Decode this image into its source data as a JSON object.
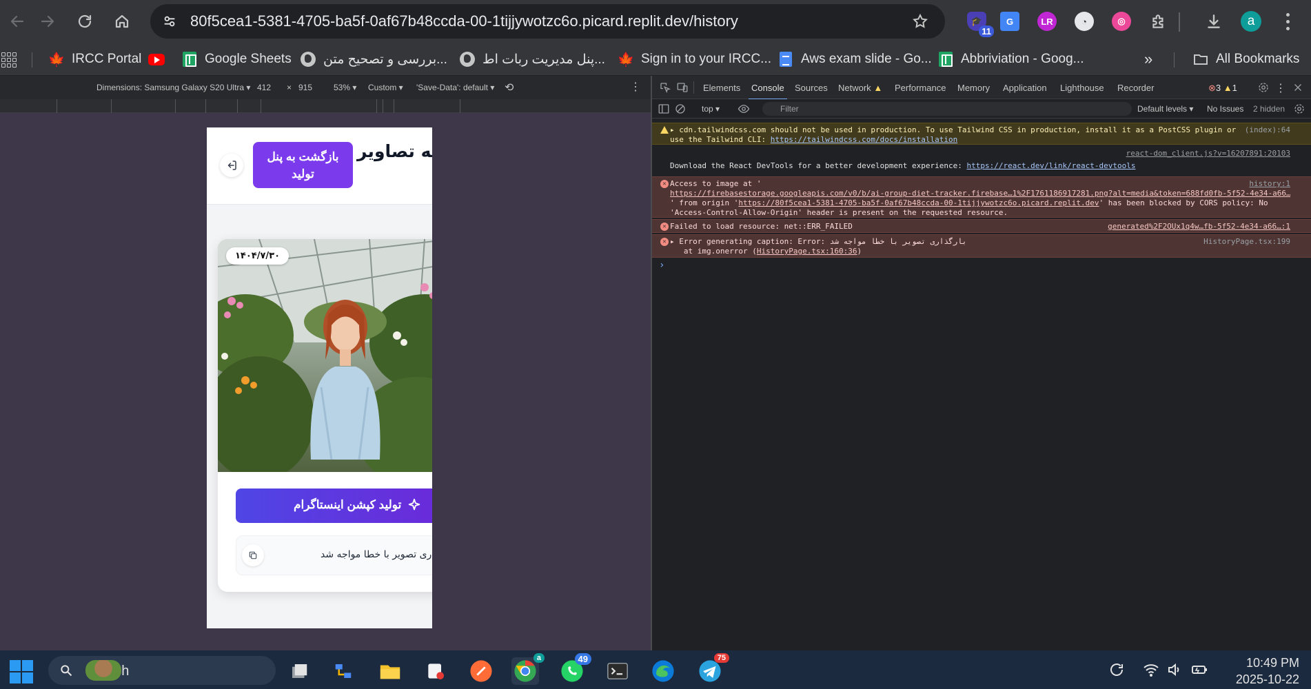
{
  "browser": {
    "url": "80f5cea1-5381-4705-ba5f-0af67b48ccda-00-1tijjywotzc6o.picard.replit.dev/history",
    "extension_badge": "11",
    "profile_initial": "a"
  },
  "bookmarks": [
    {
      "label": "IRCC Portal",
      "icon": "maple-leaf-icon"
    },
    {
      "label": "",
      "icon": "youtube-icon"
    },
    {
      "label": "Google Sheets",
      "icon": "sheets-icon"
    },
    {
      "label": "...بررسی و تصحیح متن",
      "icon": "globe-icon"
    },
    {
      "label": "...پنل مدیریت ربات اط",
      "icon": "globe-icon"
    },
    {
      "label": "Sign in to your IRCC...",
      "icon": "maple-leaf-icon"
    },
    {
      "label": "Aws exam slide - Go...",
      "icon": "docs-icon"
    },
    {
      "label": "Abbriviation - Goog...",
      "icon": "sheets-icon"
    }
  ],
  "bookmarks_all": "All Bookmarks",
  "device_toolbar": {
    "dimensions": "Dimensions: Samsung Galaxy S20 Ultra",
    "width": "412",
    "times": "×",
    "height": "915",
    "zoom": "53%",
    "throttle": "Custom",
    "save_data": "'Save-Data': default"
  },
  "app": {
    "title": "تاریخچه تصاویر",
    "back_button": "بازگشت به پنل تولید",
    "date": "۱۴۰۴/۷/۳۰",
    "generate_caption_button": "تولید کپشن اینستاگرام",
    "caption_text": "بارگذاری تصویر با خطا مواجه شد"
  },
  "devtools": {
    "tabs": [
      "Elements",
      "Console",
      "Sources",
      "Network",
      "Performance",
      "Memory",
      "Application",
      "Lighthouse",
      "Recorder"
    ],
    "active_tab": "Console",
    "error_count": "3",
    "warning_count": "1",
    "context": "top",
    "filter_placeholder": "Filter",
    "levels": "Default levels",
    "issues": "No Issues",
    "hidden": "2 hidden",
    "messages": [
      {
        "type": "warn",
        "text_a": "cdn.tailwindcss.com should not be used in production. To use Tailwind CSS in production, install it as a PostCSS plugin or",
        "text_b": "use the Tailwind CLI: ",
        "link": "https://tailwindcss.com/docs/installation",
        "source": "(index):64"
      },
      {
        "type": "info",
        "text_a": "Download the React DevTools for a better development experience: ",
        "link": "https://react.dev/link/react-devtools",
        "source": "react-dom_client.js?v=16207891:20103"
      },
      {
        "type": "err",
        "text_a": "Access to image at '",
        "link": "https://firebasestorage.googleapis.com/v0/b/ai-group-diet-tracker.firebase…1%2F1761186917281.png?alt=media&token=688fd0fb-5f52-4e34-a66…",
        "text_b": "' from origin '",
        "link2": "https://80f5cea1-5381-4705-ba5f-0af67b48ccda-00-1tijjywotzc6o.picard.replit.dev",
        "text_c": "' has been blocked by CORS policy: No",
        "text_d": "'Access-Control-Allow-Origin' header is present on the requested resource.",
        "source": "history:1"
      },
      {
        "type": "err",
        "text_a": "Failed to load resource: net::ERR_FAILED",
        "source": "generated%2F2OUx1q4w…fb-5f52-4e34-a66…:1"
      },
      {
        "type": "err",
        "text_a": "Error generating caption: Error: بارگذاری تصویر با خطا مواجه شد",
        "text_b": "at img.onerror (",
        "link": "HistoryPage.tsx:160:36",
        "text_c": ")",
        "source": "HistoryPage.tsx:199"
      }
    ],
    "prompt": "›"
  },
  "taskbar": {
    "search_label": "Search",
    "whatsapp_badge": "49",
    "telegram_badge": "75",
    "chrome_badge": "a",
    "time": "10:49 PM",
    "date": "2025-10-22"
  }
}
